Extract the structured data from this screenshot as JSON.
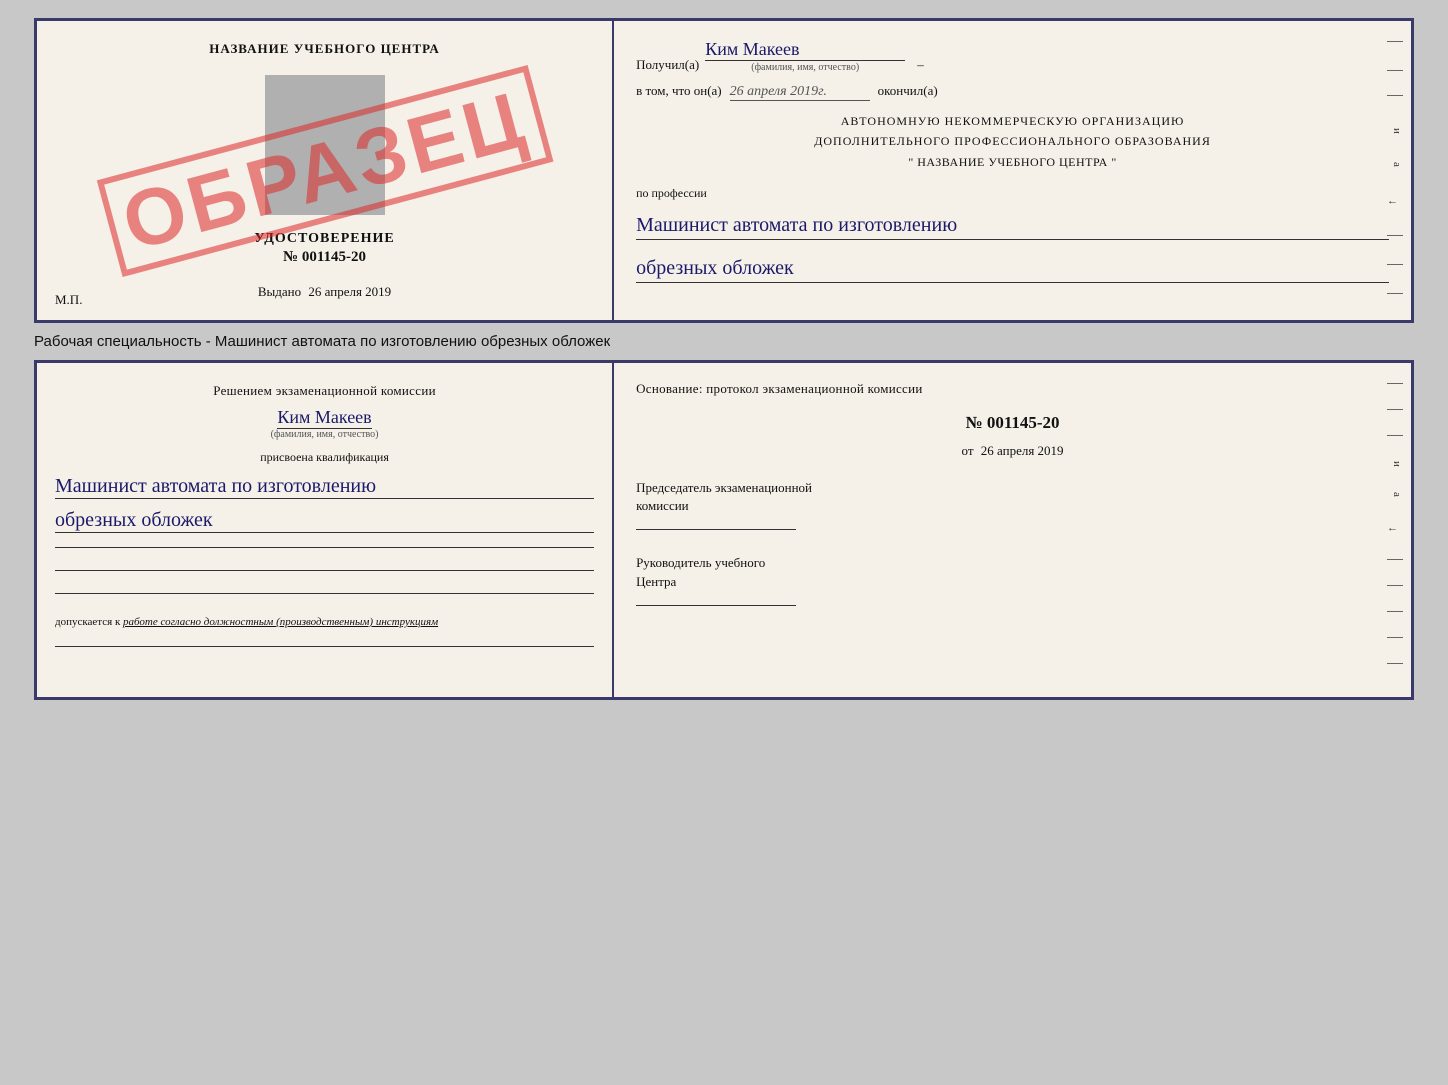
{
  "top_card": {
    "left": {
      "school_name": "НАЗВАНИЕ УЧЕБНОГО ЦЕНТРА",
      "udostoverenie": "УДОСТОВЕРЕНИЕ",
      "number": "№ 001145-20",
      "vydano_label": "Выдано",
      "vydano_date": "26 апреля 2019",
      "mp_label": "М.П.",
      "stamp": "ОБРАЗЕЦ"
    },
    "right": {
      "poluchil_prefix": "Получил(а)",
      "recipient_name": "Ким Макеев",
      "fio_hint": "(фамилия, имя, отчество)",
      "vtom_prefix": "в том, что он(а)",
      "completion_date": "26 апреля 2019г.",
      "okончил": "окончил(а)",
      "org_line1": "АВТОНОМНУЮ НЕКОММЕРЧЕСКУЮ ОРГАНИЗАЦИЮ",
      "org_line2": "ДОПОЛНИТЕЛЬНОГО ПРОФЕССИОНАЛЬНОГО ОБРАЗОВАНИЯ",
      "org_line3": "\"   НАЗВАНИЕ УЧЕБНОГО ЦЕНТРА   \"",
      "po_professii": "по профессии",
      "profession_line1": "Машинист автомата по изготовлению",
      "profession_line2": "обрезных обложек"
    }
  },
  "middle_label": "Рабочая специальность - Машинист автомата по изготовлению обрезных обложек",
  "bottom_card": {
    "left": {
      "resheniem_text": "Решением экзаменационной комиссии",
      "person_name": "Ким Макеев",
      "fio_hint": "(фамилия, имя, отчество)",
      "prisvoena_text": "присвоена квалификация",
      "kvalif_line1": "Машинист автомата по изготовлению",
      "kvalif_line2": "обрезных обложек",
      "dopuskaetsya_prefix": "допускается к",
      "dopuskaetsya_text": "работе согласно должностным (производственным) инструкциям"
    },
    "right": {
      "osnovanie_text": "Основание: протокол экзаменационной комиссии",
      "protocol_number": "№  001145-20",
      "ot_label": "от",
      "protocol_date": "26 апреля 2019",
      "predsedatel_label": "Председатель экзаменационной\nкомиссии",
      "rukovoditel_label": "Руководитель учебного\nЦентра"
    }
  },
  "right_side_labels": [
    "и",
    "а",
    "←",
    "–",
    "–",
    "–",
    "–",
    "–"
  ]
}
